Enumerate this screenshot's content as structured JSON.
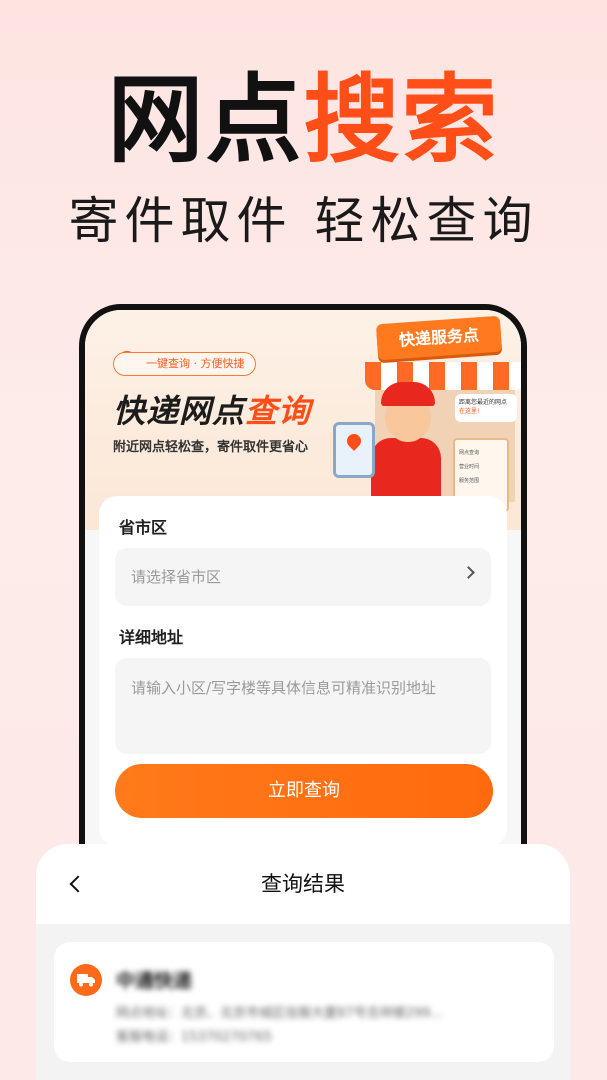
{
  "headline": {
    "dark": "网点",
    "accent": "搜索"
  },
  "subline": "寄件取件 轻松查询",
  "banner": {
    "pill": "一键查询 · 方便快捷",
    "title_dark": "快递网点",
    "title_accent": "查询",
    "desc": "附近网点轻松查，寄件取件更省心",
    "shop_sign": "快递服务点",
    "speech_line1": "距离您最近的网点",
    "speech_line2": "在这里!",
    "board_items": [
      "网点查询",
      "营业时间",
      "服务范围"
    ]
  },
  "form": {
    "region_label": "省市区",
    "region_placeholder": "请选择省市区",
    "address_label": "详细地址",
    "address_placeholder": "请输入小区/写字楼等具体信息可精准识别地址",
    "submit_label": "立即查询"
  },
  "result": {
    "title": "查询结果",
    "company": "中通快递",
    "address": "网点地址：北京、北京市城区信服大厦87号吉祥楼299...",
    "phone": "客服电话：15370270765"
  },
  "colors": {
    "accent": "#ff4e17",
    "button": "#ff7a1a"
  }
}
